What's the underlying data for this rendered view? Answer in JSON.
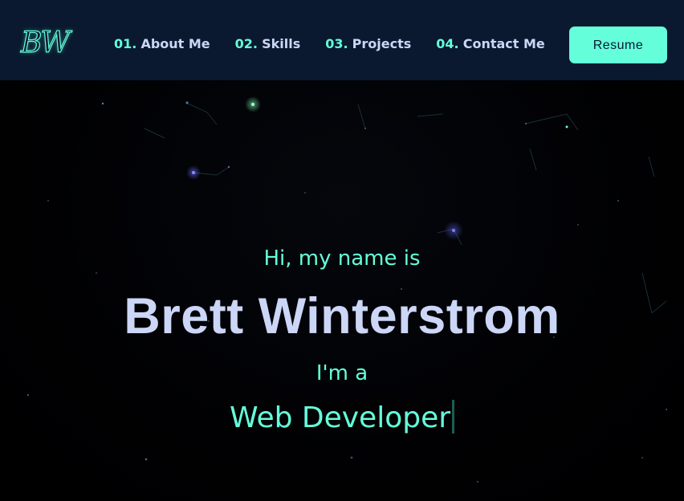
{
  "header": {
    "logo": "BW",
    "nav": [
      {
        "num": "01.",
        "label": "About Me"
      },
      {
        "num": "02.",
        "label": "Skills"
      },
      {
        "num": "03.",
        "label": "Projects"
      },
      {
        "num": "04.",
        "label": "Contact Me"
      }
    ],
    "resume_label": "Resume"
  },
  "hero": {
    "greeting": "Hi, my name is",
    "name": "Brett Winterstrom",
    "intro": "I'm a",
    "role": "Web Developer"
  },
  "colors": {
    "header_bg": "#0a192f",
    "accent": "#64ffda",
    "text": "#ccd6f6",
    "page_bg": "#000000"
  }
}
